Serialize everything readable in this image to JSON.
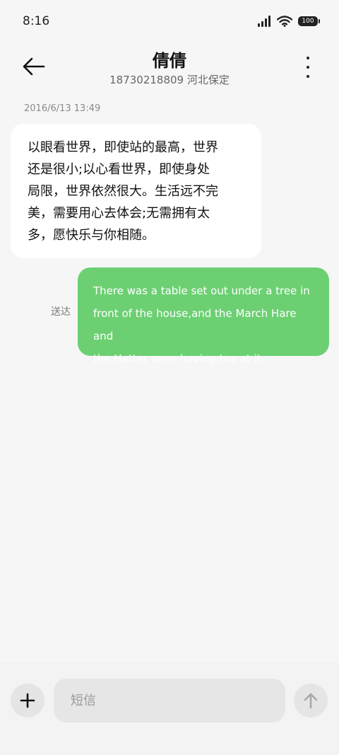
{
  "status_bar": {
    "time": "8:16",
    "battery": "100",
    "icons": [
      "signal-icon",
      "wifi-icon",
      "battery-icon"
    ]
  },
  "header": {
    "contact_name": "倩倩",
    "contact_subtitle": "18730218809 河北保定",
    "back_icon": "back-arrow-icon",
    "more_icon": "more-vertical-icon"
  },
  "conversation": {
    "timestamp": "2016/6/13 13:49",
    "messages": [
      {
        "direction": "incoming",
        "lines": [
          "以眼看世界，即使站的最高，世界",
          "还是很小;以心看世界，即使身处",
          "局限，世界依然很大。生活远不完",
          "美，需要用心去体会;无需拥有太",
          "多，愿快乐与你相随。"
        ]
      },
      {
        "direction": "outgoing",
        "lines": [
          "There was a table set out under a tree in",
          "front of the house,and the March Hare and",
          "the Hatter were having tea at it."
        ],
        "status": "送达"
      }
    ]
  },
  "composer": {
    "placeholder": "短信",
    "value": "",
    "add_icon": "plus-icon",
    "send_icon": "arrow-up-icon"
  },
  "colors": {
    "background": "#f6f6f6",
    "incoming_bubble": "#ffffff",
    "outgoing_bubble": "#6cd073",
    "input_background": "#e6e6e6"
  }
}
